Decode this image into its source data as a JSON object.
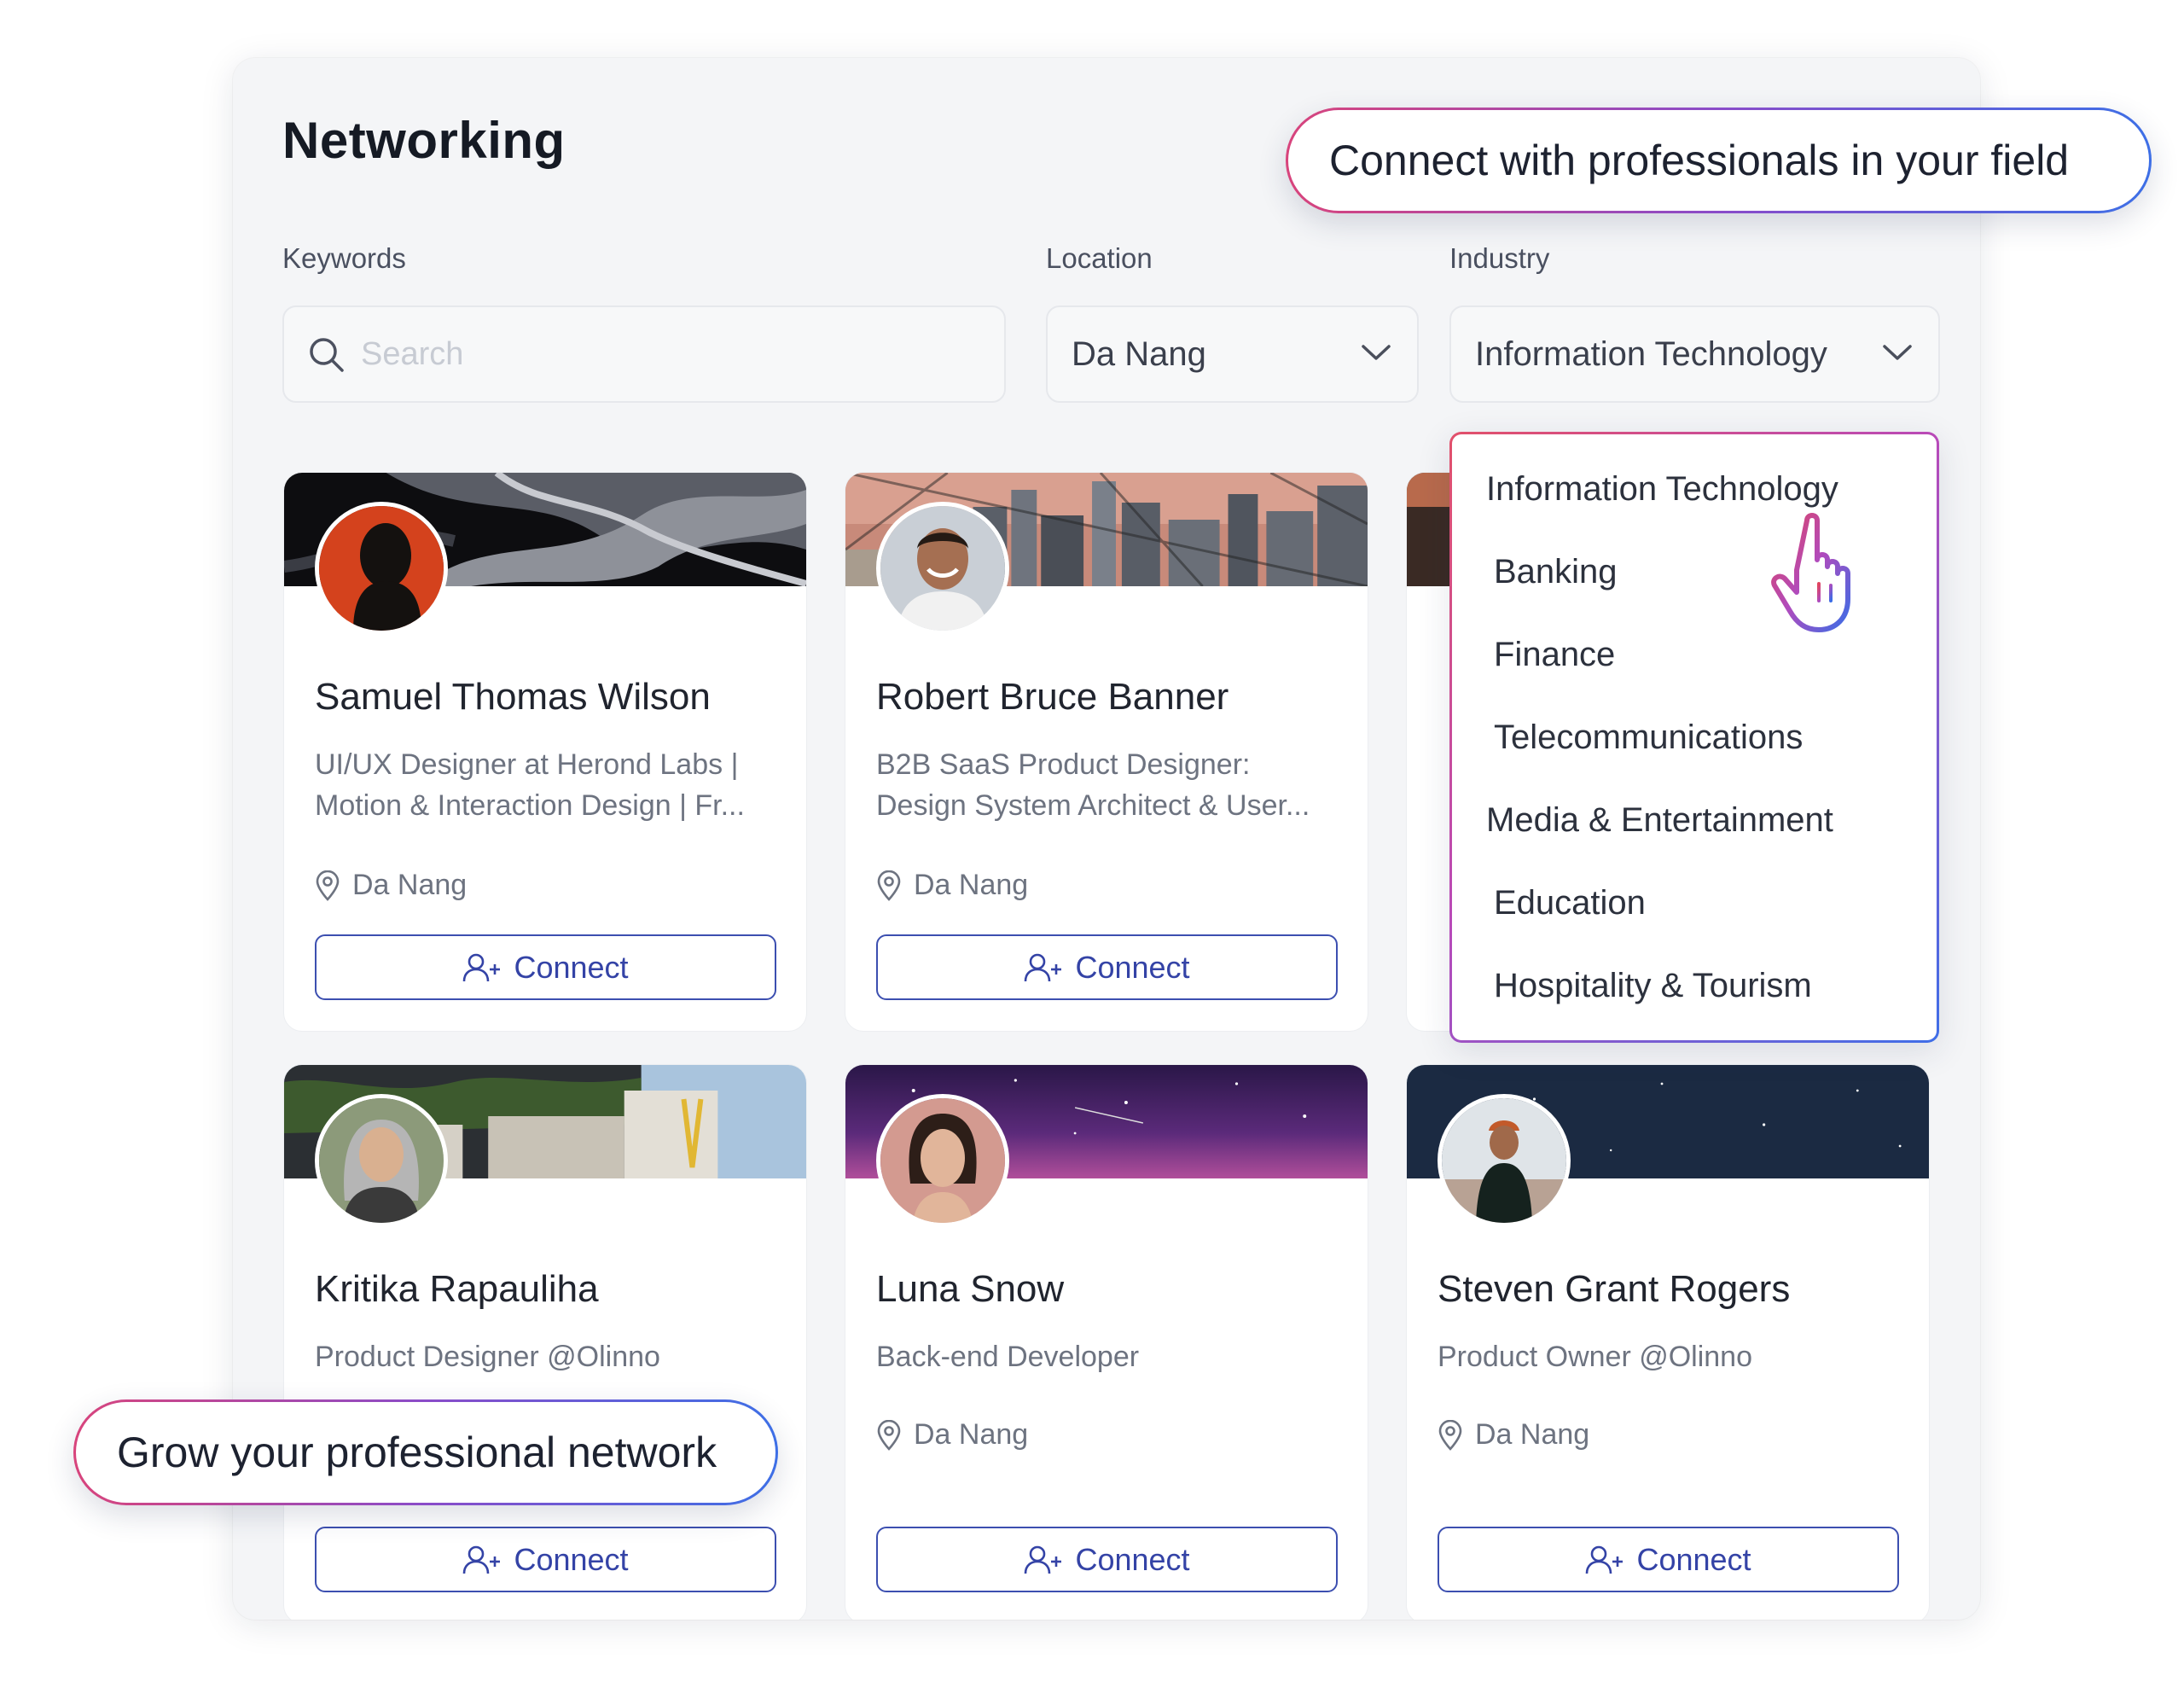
{
  "page": {
    "title": "Networking"
  },
  "filters": {
    "keywords_label": "Keywords",
    "search_placeholder": "Search",
    "location_label": "Location",
    "location_value": "Da Nang",
    "industry_label": "Industry",
    "industry_value": "Information Technology"
  },
  "industry_dropdown": {
    "options": [
      "Information Technology",
      "Banking",
      "Finance",
      "Telecommunications",
      "Media & Entertainment",
      "Education",
      "Hospitality & Tourism"
    ]
  },
  "cards": [
    {
      "name": "Samuel Thomas Wilson",
      "title_line1": "UI/UX Designer at Herond Labs |",
      "title_line2": "Motion & Interaction Design | Fr...",
      "location": "Da Nang",
      "button": "Connect"
    },
    {
      "name": "Robert Bruce Banner",
      "title_line1": "B2B SaaS Product Designer:",
      "title_line2": "Design System Architect & User...",
      "location": "Da Nang",
      "button": "Connect"
    },
    {
      "name": "Kritika Rapauliha",
      "title_line1": "Product Designer @Olinno",
      "title_line2": "",
      "location": "",
      "button": "Connect"
    },
    {
      "name": "Luna Snow",
      "title_line1": "Back-end Developer",
      "title_line2": "",
      "location": "Da Nang",
      "button": "Connect"
    },
    {
      "name": "Steven Grant Rogers",
      "title_line1": "Product Owner @Olinno",
      "title_line2": "",
      "location": "Da Nang",
      "button": "Connect"
    }
  ],
  "callouts": {
    "top": "Connect with professionals in your field",
    "bottom": "Grow your professional network"
  },
  "colors": {
    "accent_blue": "#3443a6",
    "gradient_pink": "#d8447c",
    "gradient_purple": "#8a4cc9",
    "gradient_blue": "#3d6fe6"
  }
}
